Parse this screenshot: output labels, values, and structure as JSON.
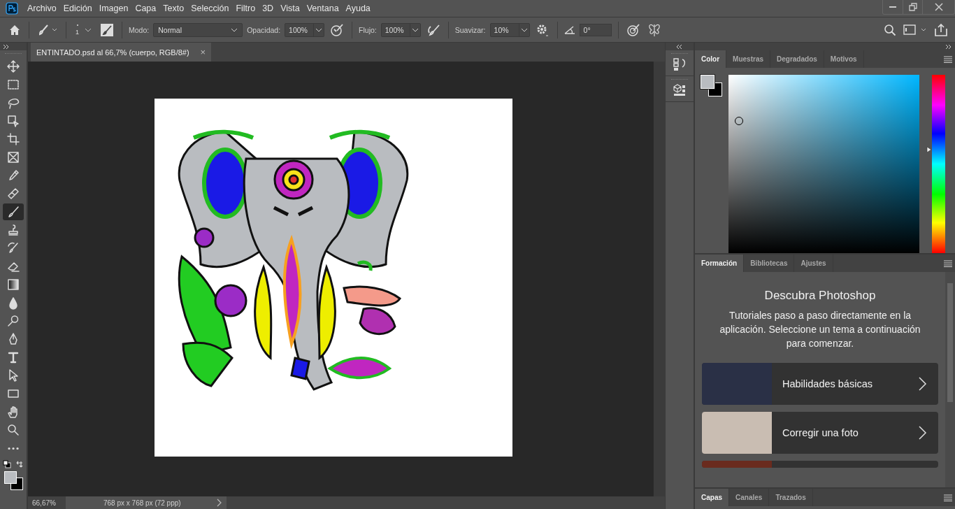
{
  "menu_bar": {
    "items": [
      "Archivo",
      "Edición",
      "Imagen",
      "Capa",
      "Texto",
      "Selección",
      "Filtro",
      "3D",
      "Vista",
      "Ventana",
      "Ayuda"
    ]
  },
  "options_bar": {
    "brush_size": "1",
    "mode": {
      "label": "Modo:",
      "value": "Normal"
    },
    "opacity": {
      "label": "Opacidad:",
      "value": "100%"
    },
    "flow": {
      "label": "Flujo:",
      "value": "100%"
    },
    "smoothing": {
      "label": "Suavizar:",
      "value": "10%"
    },
    "angle": {
      "value": "0°"
    }
  },
  "document_tab": {
    "title": "ENTINTADO.psd al 66,7% (cuerpo, RGB/8#)",
    "close": "×"
  },
  "tools": [
    {
      "kind": "move",
      "selected": false
    },
    {
      "kind": "marquee",
      "selected": false
    },
    {
      "kind": "lasso",
      "selected": false
    },
    {
      "kind": "object-select",
      "selected": false
    },
    {
      "kind": "crop",
      "selected": false
    },
    {
      "kind": "frame",
      "selected": false
    },
    {
      "kind": "eyedropper",
      "selected": false
    },
    {
      "kind": "healing",
      "selected": false
    },
    {
      "kind": "brush",
      "selected": true
    },
    {
      "kind": "stamp",
      "selected": false
    },
    {
      "kind": "history",
      "selected": false
    },
    {
      "kind": "eraser",
      "selected": false
    },
    {
      "kind": "gradient",
      "selected": false
    },
    {
      "kind": "blur",
      "selected": false
    },
    {
      "kind": "dodge",
      "selected": false
    },
    {
      "kind": "pen",
      "selected": false
    },
    {
      "kind": "type",
      "selected": false
    },
    {
      "kind": "path-select",
      "selected": false
    },
    {
      "kind": "rectangle",
      "selected": false
    },
    {
      "kind": "hand",
      "selected": false
    },
    {
      "kind": "zoom",
      "selected": false
    },
    {
      "kind": "more",
      "selected": false
    }
  ],
  "status_bar": {
    "zoom": "66,67%",
    "info": "768 px x 768 px (72 ppp)"
  },
  "color_panel": {
    "tabs": [
      {
        "label": "Color",
        "selected": true
      },
      {
        "label": "Muestras",
        "selected": false
      },
      {
        "label": "Degradados",
        "selected": false
      },
      {
        "label": "Motivos",
        "selected": false
      }
    ],
    "hue_slider": {
      "level": 0.58
    }
  },
  "learn_panel": {
    "tabs": [
      {
        "label": "Formación",
        "selected": true
      },
      {
        "label": "Bibliotecas",
        "selected": false
      },
      {
        "label": "Ajustes",
        "selected": false
      }
    ],
    "title": "Descubra Photoshop",
    "description": "Tutoriales paso a paso directamente en la aplicación. Seleccione un tema a continuación para comenzar.",
    "cards": [
      {
        "kind": "full",
        "title": "Habilidades básicas"
      },
      {
        "kind": "full",
        "title": "Corregir una foto"
      },
      {
        "kind": "partial"
      }
    ]
  },
  "layers_panel": {
    "tabs": [
      {
        "label": "Capas",
        "selected": true
      },
      {
        "label": "Canales",
        "selected": false
      },
      {
        "label": "Trazados",
        "selected": false
      }
    ]
  }
}
